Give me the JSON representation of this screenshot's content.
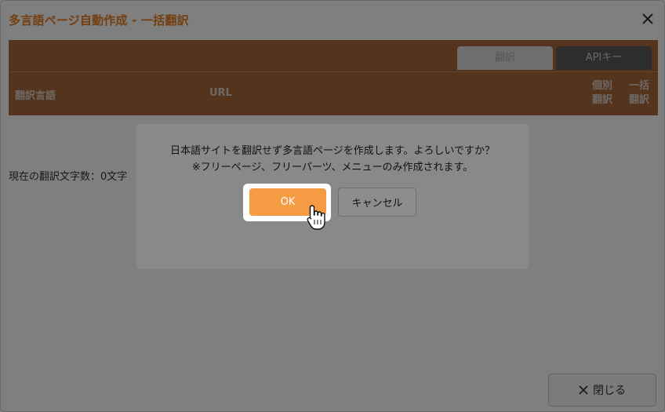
{
  "window": {
    "title": "多言語ページ自動作成 - 一括翻訳",
    "close_icon": "close-icon"
  },
  "tabs": [
    {
      "label": "翻訳"
    },
    {
      "label": "APIキー"
    }
  ],
  "table": {
    "columns": {
      "language": "翻訳言語",
      "url": "URL",
      "individual_line1": "個別",
      "individual_line2": "翻訳",
      "bulk_line1": "一括",
      "bulk_line2": "翻訳"
    }
  },
  "stats": {
    "label": "現在の翻訳文字数：0文字"
  },
  "dialog": {
    "message_line1": "日本語サイトを翻訳せず多言語ページを作成します。よろしいですか？",
    "message_line2": "※フリーページ、フリーパーツ、メニューのみ作成されます。",
    "ok_label": "OK",
    "cancel_label": "キャンセル"
  },
  "footer": {
    "close_label": "閉じる"
  },
  "colors": {
    "accent": "#f59b43",
    "title": "#e67e22",
    "header_bg": "#a8683a"
  }
}
